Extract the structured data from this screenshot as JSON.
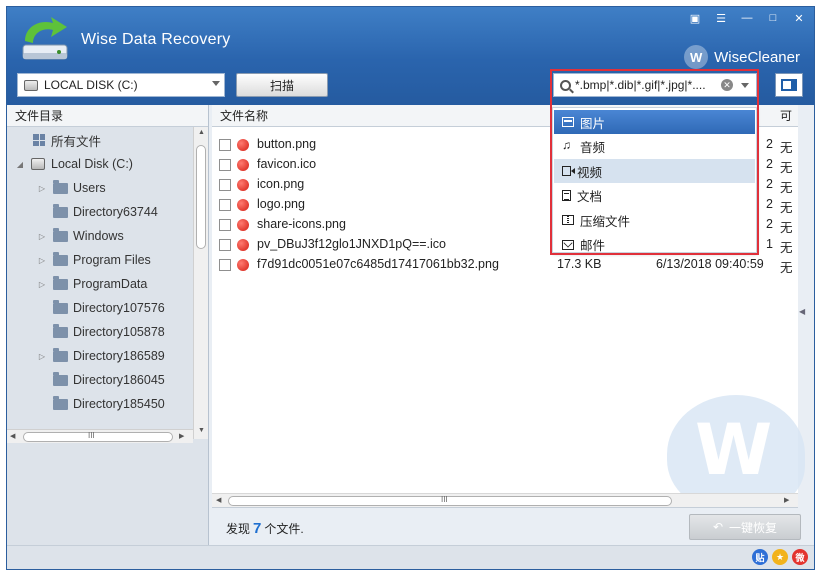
{
  "app": {
    "title": "Wise Data Recovery",
    "brand": "WiseCleaner",
    "brand_badge": "W"
  },
  "toolbar": {
    "drive_label": "LOCAL DISK (C:)",
    "scan_label": "扫描",
    "filter_value": "*.bmp|*.dib|*.gif|*.jpg|*...."
  },
  "tree": {
    "header": "文件目录",
    "items": [
      {
        "label": "所有文件",
        "kind": "all",
        "expander": ""
      },
      {
        "label": "Local Disk (C:)",
        "kind": "disk",
        "expander": "◢"
      },
      {
        "label": "Users",
        "kind": "folder",
        "expander": "▷"
      },
      {
        "label": "Directory63744",
        "kind": "folder",
        "expander": ""
      },
      {
        "label": "Windows",
        "kind": "folder",
        "expander": "▷"
      },
      {
        "label": "Program Files",
        "kind": "folder",
        "expander": "▷"
      },
      {
        "label": "ProgramData",
        "kind": "folder",
        "expander": "▷"
      },
      {
        "label": "Directory107576",
        "kind": "folder",
        "expander": ""
      },
      {
        "label": "Directory105878",
        "kind": "folder",
        "expander": ""
      },
      {
        "label": "Directory186589",
        "kind": "folder",
        "expander": "▷"
      },
      {
        "label": "Directory186045",
        "kind": "folder",
        "expander": ""
      },
      {
        "label": "Directory185450",
        "kind": "folder",
        "expander": ""
      }
    ],
    "hscroll_label": "III"
  },
  "list": {
    "header_name": "文件名称",
    "header_recover": "可",
    "rows": [
      {
        "name": "button.png",
        "size": "",
        "date": "",
        "date_tail": "2",
        "recover": "无"
      },
      {
        "name": "favicon.ico",
        "size": "",
        "date": "",
        "date_tail": "2",
        "recover": "无"
      },
      {
        "name": "icon.png",
        "size": "",
        "date": "",
        "date_tail": "2",
        "recover": "无"
      },
      {
        "name": "logo.png",
        "size": "",
        "date": "",
        "date_tail": "2",
        "recover": "无"
      },
      {
        "name": "share-icons.png",
        "size": "",
        "date": "",
        "date_tail": "2",
        "recover": "无"
      },
      {
        "name": "pv_DBuJ3f12glo1JNXD1pQ==.ico",
        "size": "",
        "date": "",
        "date_tail": "1",
        "recover": "无"
      },
      {
        "name": "f7d91dc0051e07c6485d17417061bb32.png",
        "size": "17.3 KB",
        "date": "6/13/2018 09:40:59",
        "date_tail": "",
        "recover": "无"
      }
    ],
    "hscroll_label": "III"
  },
  "footer": {
    "found_prefix": "发现",
    "found_count": "7",
    "found_suffix": "个文件.",
    "recover_label": "一键恢复"
  },
  "dropdown": {
    "items": [
      {
        "label": "图片",
        "icon": "image-icon",
        "state": "selected"
      },
      {
        "label": "音频",
        "icon": "music-icon",
        "state": ""
      },
      {
        "label": "视频",
        "icon": "video-icon",
        "state": "hover"
      },
      {
        "label": "文档",
        "icon": "document-icon",
        "state": ""
      },
      {
        "label": "压缩文件",
        "icon": "archive-icon",
        "state": ""
      },
      {
        "label": "邮件",
        "icon": "mail-icon",
        "state": ""
      }
    ]
  },
  "status": {
    "icons": [
      {
        "name": "tieba-icon",
        "glyph": "贴",
        "color": "#2e6fd6"
      },
      {
        "name": "favorite-icon",
        "glyph": "★",
        "color": "#f2b31c"
      },
      {
        "name": "weibo-icon",
        "glyph": "微",
        "color": "#e3342f"
      }
    ]
  },
  "watermark": {
    "letter": "W"
  },
  "colors": {
    "titlebar": "#2a64ad",
    "highlight_frame": "#e0303a",
    "selection": "#2f69b6",
    "found_count": "#1e6fd0",
    "deleted_dot": "#d41e14"
  }
}
